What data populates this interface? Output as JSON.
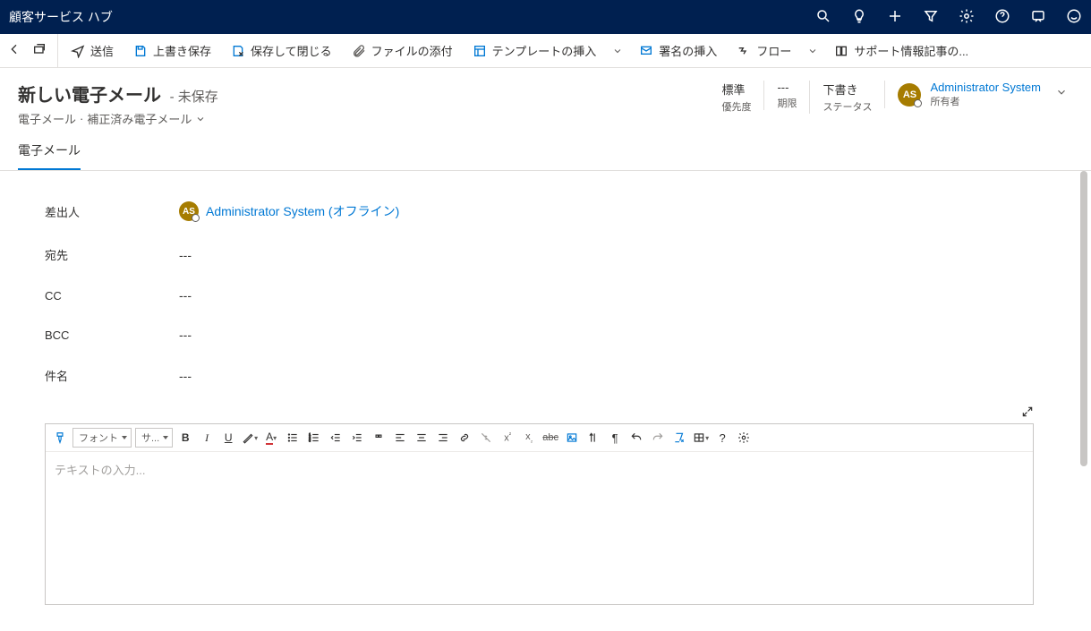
{
  "topbar": {
    "title": "顧客サービス ハブ"
  },
  "cmdbar": {
    "send": "送信",
    "saveDraft": "上書き保存",
    "saveClose": "保存して閉じる",
    "attach": "ファイルの添付",
    "template": "テンプレートの挿入",
    "signature": "署名の挿入",
    "flow": "フロー",
    "kb": "サポート情報記事の..."
  },
  "header": {
    "title": "新しい電子メール",
    "unsaved": "- 未保存",
    "bc1": "電子メール",
    "bc2": "補正済み電子メール",
    "priority_val": "標準",
    "priority_lbl": "優先度",
    "due_val": "---",
    "due_lbl": "期限",
    "status_val": "下書き",
    "status_lbl": "ステータス",
    "owner_initials": "AS",
    "owner_name": "Administrator System",
    "owner_lbl": "所有者"
  },
  "tabs": {
    "email": "電子メール"
  },
  "fields": {
    "from_lbl": "差出人",
    "from_initials": "AS",
    "from_name": "Administrator System (オフライン)",
    "to_lbl": "宛先",
    "to_val": "---",
    "cc_lbl": "CC",
    "cc_val": "---",
    "bcc_lbl": "BCC",
    "bcc_val": "---",
    "subject_lbl": "件名",
    "subject_val": "---"
  },
  "editor": {
    "font_label": "フォント",
    "size_label": "サ...",
    "placeholder": "テキストの入力..."
  }
}
